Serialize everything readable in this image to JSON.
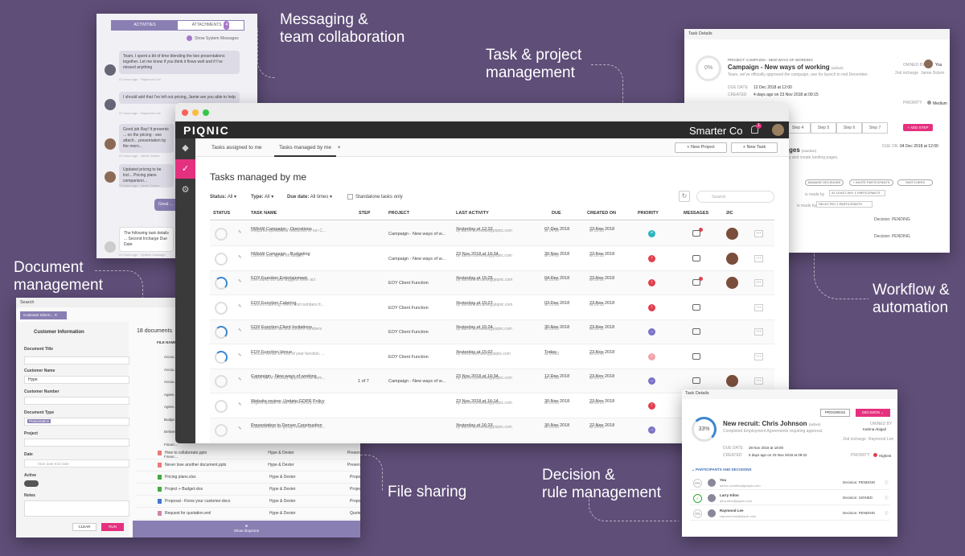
{
  "callouts": {
    "messaging": "Messaging &\nteam collaboration",
    "task": "Task & project\nmanagement",
    "document": "Document\nmanagement",
    "workflow": "Workflow &\nautomation",
    "file": "File sharing",
    "decision": "Decision &\nrule management"
  },
  "chat": {
    "tab_activities": "ACTIVITIES",
    "tab_attachments": "ATTACHMENTS",
    "attach_count": "4",
    "show_system": "Show System Messages",
    "messages": [
      {
        "text": "Team, I spent a bit of time blending the two presentations together. Let me know if you think it flows well and if I've missed anything",
        "meta": "21 hours ago · Raymond Lee"
      },
      {
        "text": "I should add that I've left out pricing, Jamie are you able to help",
        "meta": "21 hours ago · Raymond Lee"
      },
      {
        "text": "Good job Ray! It presents ... on the pricing - see attach... presentation by the morn...",
        "meta": "21 hours ago · Jamie Dobon"
      },
      {
        "text": "Updated pricing to be incl... Pricing plans comparison...",
        "meta": "21 hours ago · Jamie Dobon"
      },
      {
        "text": "Great ...",
        "meta": ""
      },
      {
        "text": "The following task details ... Second Incharge Due Date",
        "meta": "21 hours ago · System message"
      }
    ]
  },
  "td1": {
    "header": "Task Details",
    "pct": "0%",
    "project_label": "PROJECT: CAMPAIGN - NEW WAYS OF WORKING",
    "title": "Campaign - New ways of working",
    "state": "(active)",
    "desc": "Team, we've officially approved the campaign, see for launch in mid December.",
    "owned_by": "OWNED BY",
    "owner": "You",
    "second": "2nd incharge",
    "second_name": "Jamie Dobon",
    "due_label": "DUE DATE",
    "due": "12 Dec 2018 at 12:00",
    "created_label": "CREATED",
    "created": "4 days ago on 23 Nov 2018 at 09:15",
    "priority_label": "PRIORITY",
    "priority": "Medium",
    "steps": [
      "Step 4",
      "Step 5",
      "Step 6",
      "Step 7"
    ],
    "add_step": "+ ADD STEP",
    "partial_title": "ges",
    "partial_state": "(inactive)",
    "partial_desc": "y and create landing pages.",
    "due_on": "DUE ON",
    "due_on_val": "04 Dec 2018 at 12:00",
    "chip_manage": "MANAGE DECISIONS",
    "chip_invite": "+ INVITE PARTICIPANTS",
    "chip_switch": "SWITCHERS",
    "made_by": "is made by",
    "sel1": "AT LEAST ANY 1 PARTICIPANTS",
    "made_by2": "is made by",
    "sel2": "SELECTED 2 PARTICIPANTS",
    "decision1": "Decision: PENDING",
    "decision2": "Decision: PENDING"
  },
  "docs": {
    "search": "Search",
    "chip": "Customer Inform...",
    "panel_title": "Customer Information",
    "fields": [
      {
        "label": "Document Title",
        "value": ""
      },
      {
        "label": "Customer Name",
        "value": "Hype"
      },
      {
        "label": "Customer Number",
        "value": ""
      },
      {
        "label": "Document Type",
        "value": "Presentation"
      },
      {
        "label": "Project",
        "value": ""
      },
      {
        "label": "Date",
        "value": "Start date       End date"
      },
      {
        "label": "Active",
        "value": ""
      },
      {
        "label": "Notes",
        "value": ""
      }
    ],
    "and": "AND",
    "clear": "CLEAR",
    "run": "RUN",
    "count": "18 documents",
    "col_file": "FILE NAME",
    "files": [
      {
        "name": "How to collaborate.pptx",
        "cust": "Hype & Dexter",
        "type": "Presentation"
      },
      {
        "name": "Never lose another document.pptx",
        "cust": "Hype & Dexter",
        "type": "Presentation"
      },
      {
        "name": "Pricing plans.xlsx",
        "cust": "Hype & Dexter",
        "type": "Proposals"
      },
      {
        "name": "Project + Budget.xlsx",
        "cust": "Hype & Dexter",
        "type": "Project"
      },
      {
        "name": "Proposal - Know your customer.docx",
        "cust": "Hype & Dexter",
        "type": "Proposals"
      },
      {
        "name": "Request for quotation.eml",
        "cust": "Hype & Dexter",
        "type": "Quotes"
      }
    ],
    "partial_files": [
      "Accou...",
      "Accou...",
      "Accou...",
      "Agree...",
      "Agree...",
      "Budge...",
      "Deliver...",
      "Financ...",
      "Financ..."
    ],
    "dropzone": "Show dropzone"
  },
  "main": {
    "logo": "PIQNIC",
    "company": "Smarter Co",
    "notif": "1",
    "tab1": "Tasks assigned to me",
    "tab2": "Tasks managed by me",
    "new_project": "+ New Project",
    "new_task": "+ New Task",
    "heading": "Tasks managed by me",
    "f_status": "Status:",
    "f_status_v": "All",
    "f_type": "Type:",
    "f_type_v": "All",
    "f_due": "Due date:",
    "f_due_v": "All times",
    "standalone": "Standalone tasks only",
    "search_ph": "Search",
    "cols": [
      "STATUS",
      "TASK NAME",
      "STEP",
      "PROJECT",
      "LAST ACTIVITY",
      "DUE",
      "CREATED ON",
      "PRIORITY",
      "MESSAGES",
      "2IC"
    ],
    "rows": [
      {
        "name": "NWoW Campaign - Operations",
        "desc": "Required operational resources to run C...",
        "step": "",
        "project": "Campaign - New ways of w...",
        "act": "Yesterday at 12:22",
        "by": "by aaron.cornelius@piqnic.com",
        "due": "07 Dec 2018",
        "due_t": "at 14:00",
        "cr": "23 Nov 2018",
        "cr_t": "at 10:28",
        "prio": "#2bb3c0",
        "pg": "×",
        "face": true,
        "msgdot": true
      },
      {
        "name": "NWoW Campaign - Budgeting",
        "desc": "Confirm and agree on budget",
        "step": "",
        "project": "Campaign - New ways of w...",
        "act": "23 Nov 2018 at 10:34",
        "by": "by aaron.cornelius@piqnic.com",
        "due": "30 Nov 2018",
        "due_t": "at 14:00",
        "cr": "23 Nov 2018",
        "cr_t": "at 10:33",
        "prio": "#e0404f",
        "pg": "↑",
        "face": true,
        "msgdot": false
      },
      {
        "name": "EOY Function Entertainment",
        "desc": "Live band, DJ and suggest other act",
        "step": "",
        "project": "EOY Client Function",
        "act": "Yesterday at 15:25",
        "by": "by samantha.cahill@piqnic.com",
        "due": "04 Dec 2018",
        "due_t": "at 15:00",
        "cr": "23 Nov 2018",
        "cr_t": "at 09:56",
        "prio": "#e0404f",
        "pg": "↑",
        "face": true,
        "msgdot": true
      },
      {
        "name": "EOY Function Catering",
        "desc": "Confirm catering, menu and numbers fr...",
        "step": "",
        "project": "EOY Client Function",
        "act": "Yesterday at 15:27",
        "by": "by samantha.cahill@piqnic.com",
        "due": "03 Dec 2018",
        "due_t": "at 15:00",
        "cr": "23 Nov 2018",
        "cr_t": "at 09:53",
        "prio": "#e0404f",
        "pg": "↑",
        "face": false,
        "msgdot": false
      },
      {
        "name": "EOY Function Client Invitations",
        "desc": "Build invitation list and confirm numbers",
        "step": "",
        "project": "EOY Client Function",
        "act": "Yesterday at 15:24",
        "by": "by aaron.cornelius@piqnic.com",
        "due": "30 Nov 2018",
        "due_t": "at 15:00",
        "cr": "23 Nov 2018",
        "cr_t": "at 09:51",
        "prio": "#7b72c7",
        "pg": "→",
        "face": false,
        "msgdot": false
      },
      {
        "name": "EOY Function Venue",
        "desc": "Choose venue for end of year function. ...",
        "step": "",
        "project": "EOY Client Function",
        "act": "Yesterday at 15:07",
        "by": "by brent.morrison@piqnic.com",
        "due": "Today",
        "due_t": "at 15:00",
        "cr": "23 Nov 2018",
        "cr_t": "at 09:48",
        "prio": "#f1a5ad",
        "pg": "↑",
        "face": false,
        "msgdot": false
      },
      {
        "name": "Campaign - New ways of working",
        "desc": "Team, we've officially approved the cam...",
        "step": "1 of 7",
        "project": "Campaign - New ways of w...",
        "act": "23 Nov 2018 at 10:34",
        "by": "by aaron.cornelius@piqnic.com",
        "due": "12 Dec 2018",
        "due_t": "at 12:00",
        "cr": "23 Nov 2018",
        "cr_t": "at 09:15",
        "prio": "#7b72c7",
        "pg": "→",
        "face": true,
        "msgdot": false
      },
      {
        "name": "Website review: Update GDPR Policy",
        "desc": "Urgent update of our GDPR policy is req...",
        "step": "",
        "project": "",
        "act": "23 Nov 2018 at 16:14",
        "by": "by aaron.cornelius@piqnic.com",
        "due": "30 Nov 2018",
        "due_t": "at 10:00",
        "cr": "23 Nov 2018",
        "cr_t": "at 09:10",
        "prio": "#e0404f",
        "pg": "↑",
        "face": false,
        "msgdot": false
      },
      {
        "name": "Presentation to Denver Construction",
        "desc": "Attached draft for group review. We'll ne...",
        "step": "",
        "project": "",
        "act": "Yesterday at 16:23",
        "by": "by aaron.cornelius@piqnic.com",
        "due": "30 Nov 2018",
        "due_t": "at 10:00",
        "cr": "22 Nov 2018",
        "cr_t": "at 15:06",
        "prio": "#7b72c7",
        "pg": "→",
        "face": false,
        "msgdot": false
      }
    ]
  },
  "td2": {
    "header": "Task Details",
    "progress": "PROGRESS",
    "decision": "DECISION ⌄",
    "pct": "33%",
    "title": "New recruit: Chris Johnson",
    "state": "(active)",
    "desc": "Completed Employment Agreements requiring approval.",
    "owned_by": "OWNED BY",
    "owner": "Katrina Abigail",
    "second": "2nd incharge",
    "second_name": "Raymond Lee",
    "due_label": "DUE DATE",
    "due": "28 Nov 2018 at 18:00",
    "created_label": "CREATED",
    "created": "5 days ago on 23 Nov 2018 at 09:22",
    "priority_label": "PRIORITY",
    "priority": "Highest",
    "section": "⌄ PARTICIPANTS AND DECISIONS",
    "parts": [
      {
        "pct": "0%",
        "name": "You",
        "email": "aaron.cornelius@piqnic.com",
        "dec": "Decision: PENDING"
      },
      {
        "pct": "✓",
        "name": "Larry Kilon",
        "email": "larry.kilon@piqnic.com",
        "dec": "Decision: SIGNED"
      },
      {
        "pct": "0%",
        "name": "Raymond Lee",
        "email": "raymond.lee@piqnic.com",
        "dec": "Decision: PENDING"
      }
    ]
  }
}
